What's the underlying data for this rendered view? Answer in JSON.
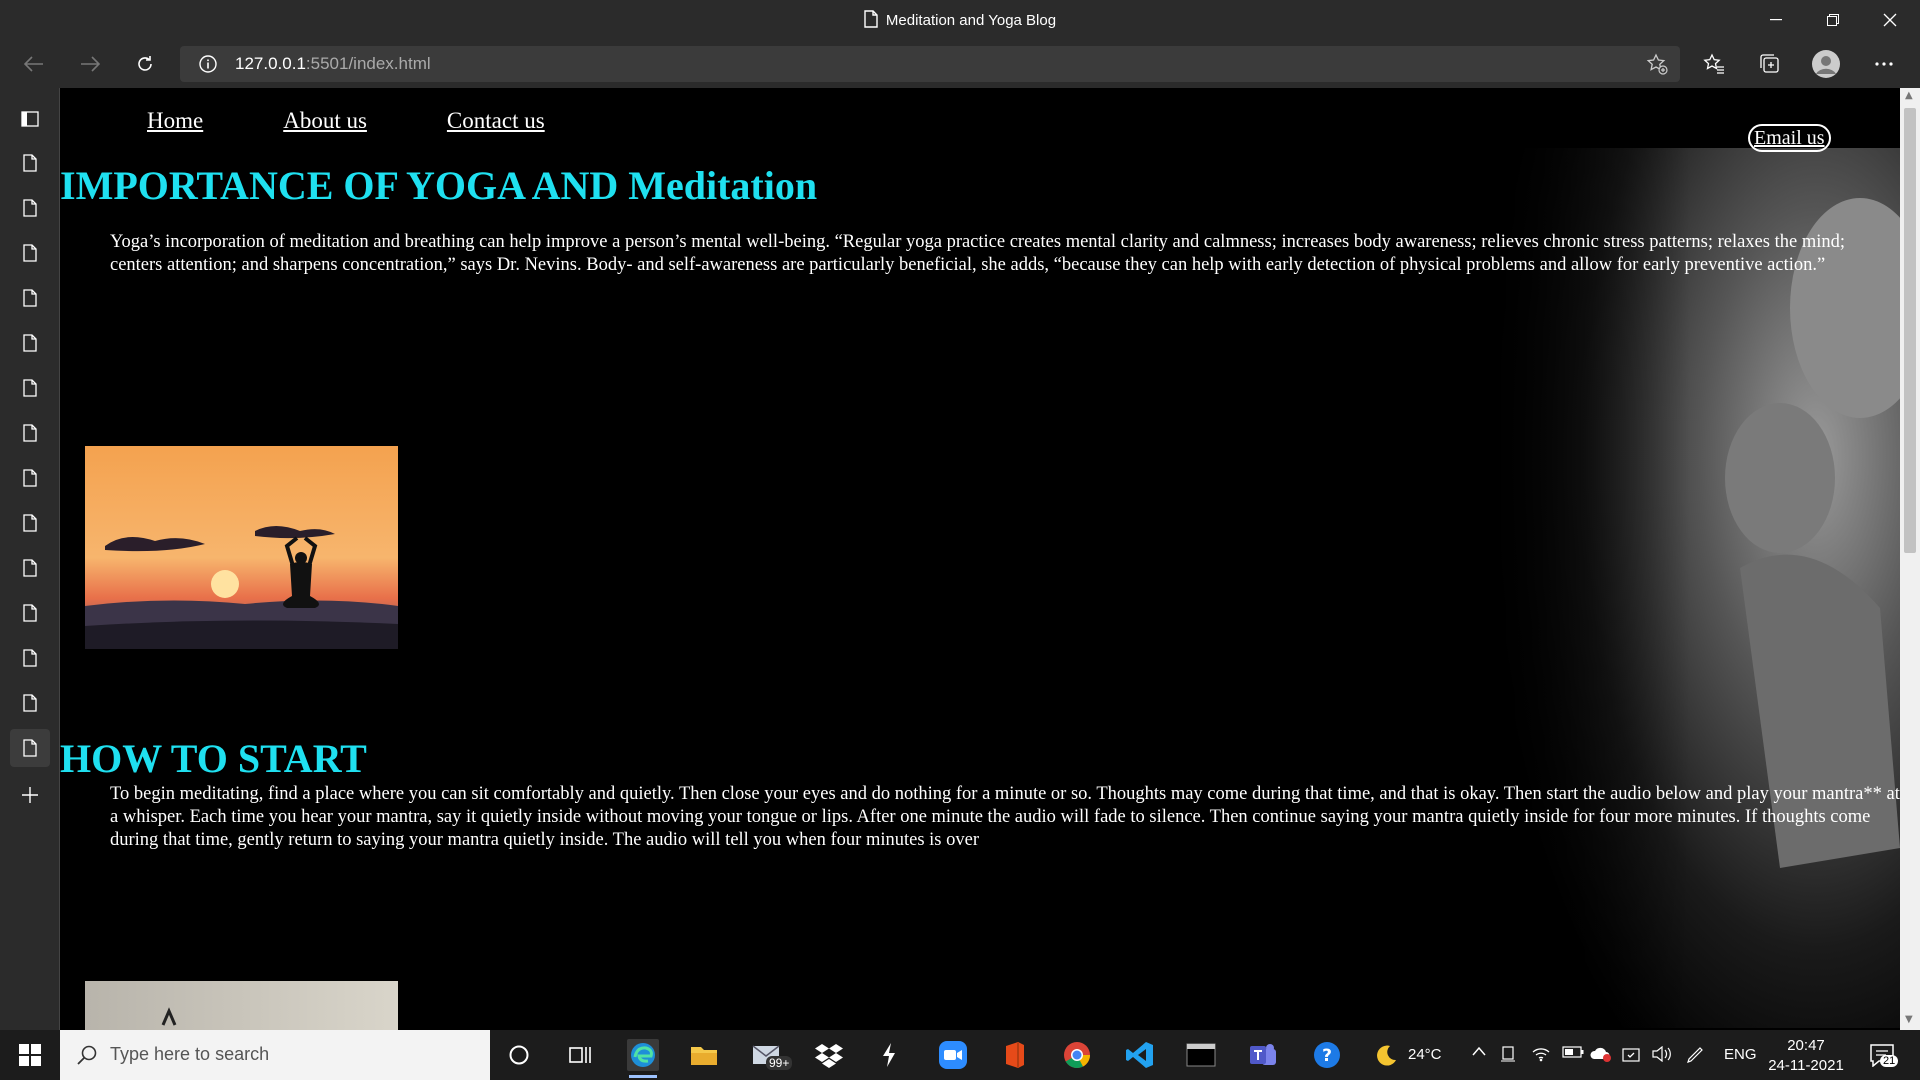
{
  "window": {
    "title": "Meditation and Yoga Blog"
  },
  "addressbar": {
    "url_host": "127.0.0.1",
    "url_rest": ":5501/index.html"
  },
  "page": {
    "nav": [
      "Home",
      "About us",
      "Contact us"
    ],
    "email_button": "Email us",
    "heading1": "IMPORTANCE OF YOGA AND Meditation",
    "para1": "Yoga’s incorporation of meditation and breathing can help improve a person’s mental well-being. “Regular yoga practice creates mental clarity and calmness; increases body awareness; relieves chronic stress patterns; relaxes the mind; centers attention; and sharpens concentration,” says Dr. Nevins. Body- and self-awareness are particularly beneficial, she adds, “because they can help with early detection of physical problems and allow for early preventive action.”",
    "heading2": "HOW TO START",
    "para2": "To begin meditating, find a place where you can sit comfortably and quietly. Then close your eyes and do nothing for a minute or so. Thoughts may come during that time, and that is okay. Then start the audio below and play your mantra** at a whisper. Each time you hear your mantra, say it quietly inside without moving your tongue or lips. After one minute the audio will fade to silence. Then continue saying your mantra quietly inside for four more minutes. If thoughts come during that time, gently return to saying your mantra quietly inside. The audio will tell you when four minutes is over"
  },
  "taskbar": {
    "search_placeholder": "Type here to search",
    "mail_badge": "99+",
    "weather": "24°C",
    "language": "ENG",
    "time": "20:47",
    "date": "24-11-2021",
    "notifications": "21"
  },
  "colors": {
    "heading": "#1fe0f0",
    "page_bg": "#000000",
    "chrome_bg": "#2b2b2b"
  }
}
